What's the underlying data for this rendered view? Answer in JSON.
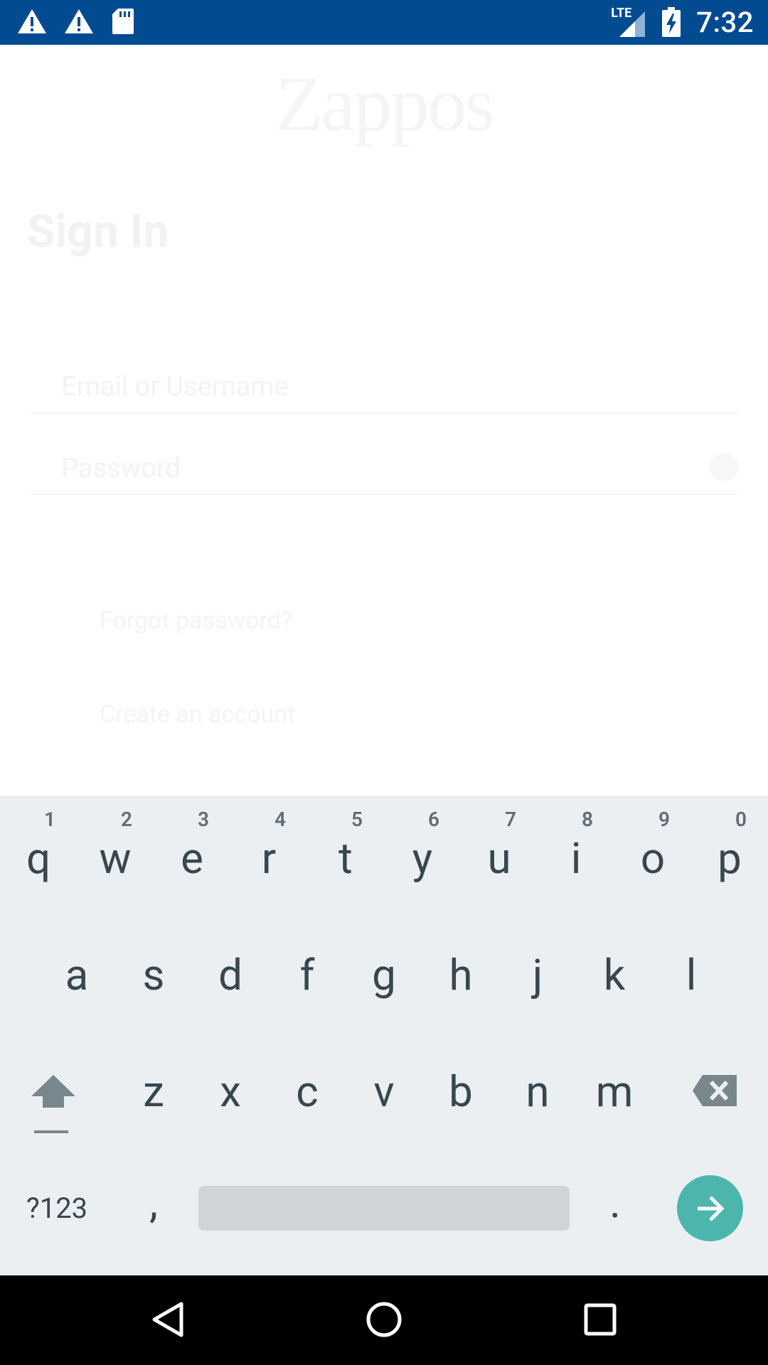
{
  "status_bar": {
    "time": "7:32",
    "left_icons": [
      "warning-icon",
      "warning-icon",
      "sd-card-icon"
    ],
    "right_icons": [
      "lte-signal-icon",
      "battery-charging-icon"
    ],
    "network_label": "LTE",
    "background": "#024b91"
  },
  "app": {
    "logo_text": "Zappos",
    "title": "Sign In",
    "email_label": "Email or Username",
    "password_label": "Password",
    "forgot_link": "Forgot password?",
    "create_link": "Create an account"
  },
  "keyboard": {
    "row1": [
      "q",
      "w",
      "e",
      "r",
      "t",
      "y",
      "u",
      "i",
      "o",
      "p"
    ],
    "row1_hints": [
      "1",
      "2",
      "3",
      "4",
      "5",
      "6",
      "7",
      "8",
      "9",
      "0"
    ],
    "row2": [
      "a",
      "s",
      "d",
      "f",
      "g",
      "h",
      "j",
      "k",
      "l"
    ],
    "row3": [
      "z",
      "x",
      "c",
      "v",
      "b",
      "n",
      "m"
    ],
    "symbols_key": "?123",
    "comma_key": ",",
    "period_key": ".",
    "accent_color": "#4db6ac"
  },
  "nav_bar": {
    "buttons": [
      "back-icon",
      "home-icon",
      "recents-icon"
    ]
  }
}
